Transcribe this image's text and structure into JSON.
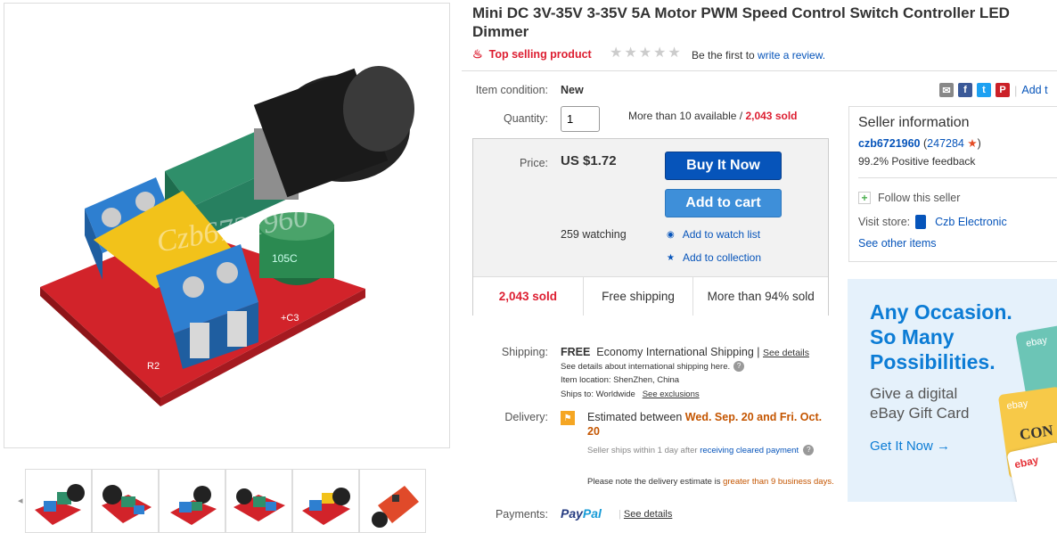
{
  "title": "Mini DC 3V-35V 3-35V 5A Motor PWM Speed Control Switch Controller LED Dimmer",
  "top_selling": "Top selling product",
  "review_prefix": "Be the first to",
  "review_link": "write a review.",
  "watermark": "Czb6721960",
  "item_condition": {
    "label": "Item condition:",
    "value": "New"
  },
  "quantity": {
    "label": "Quantity:",
    "value": "1",
    "availability": "More than 10 available",
    "separator": "/",
    "sold": "2,043 sold"
  },
  "price": {
    "label": "Price:",
    "value": "US $1.72"
  },
  "buttons": {
    "buy_now": "Buy It Now",
    "add_to_cart": "Add to cart"
  },
  "watching": "259 watching",
  "watch_list": "Add to watch list",
  "collection": "Add to collection",
  "stats": {
    "sold": "2,043 sold",
    "shipping": "Free shipping",
    "percent": "More than 94% sold"
  },
  "shipping": {
    "label": "Shipping:",
    "free": "FREE",
    "method": "Economy International Shipping |",
    "see_details": "See details",
    "intl_note": "See details about international shipping here.",
    "item_location_label": "Item location:",
    "item_location": "ShenZhen, China",
    "ships_to_label": "Ships to:",
    "ships_to": "Worldwide",
    "see_exclusions": "See exclusions"
  },
  "delivery": {
    "label": "Delivery:",
    "prefix": "Estimated between",
    "dates": "Wed. Sep. 20 and Fri. Oct. 20",
    "seller_ships": "Seller ships within 1 day after",
    "cleared_payment": "receiving cleared payment",
    "note_prefix": "Please note the delivery estimate is",
    "note_highlight": "greater than 9 business days."
  },
  "payments": {
    "label": "Payments:",
    "paypal_pay": "Pay",
    "paypal_pal": "Pal",
    "see_details": "See details"
  },
  "share": {
    "add_link": "Add t"
  },
  "seller": {
    "heading": "Seller information",
    "username": "czb6721960",
    "feedback_score": "247284",
    "positive": "99.2% Positive feedback",
    "follow": "Follow this seller",
    "visit_label": "Visit store:",
    "store_name": "Czb Electronic",
    "other_items": "See other items"
  },
  "ad": {
    "headline": [
      "Any Occasion.",
      "So Many",
      "Possibilities."
    ],
    "sub": [
      "Give a digital",
      "eBay Gift Card"
    ],
    "cta": "Get It Now →",
    "card_brand": "ebay",
    "card_text": "CON"
  },
  "colors": {
    "link": "#0654ba",
    "red": "#dd1e31",
    "orange": "#c45500",
    "buy_button": "#0654ba",
    "cart_button": "#3e8fd9",
    "ad_blue": "#0c7cd5"
  }
}
